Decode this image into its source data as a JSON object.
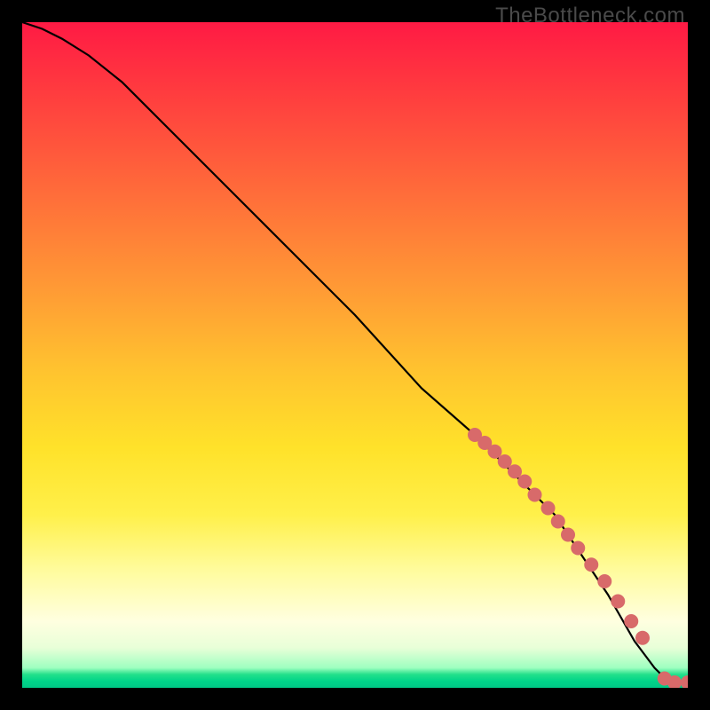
{
  "watermark": "TheBottleneck.com",
  "chart_data": {
    "type": "line",
    "title": "",
    "xlabel": "",
    "ylabel": "",
    "xlim": [
      0,
      100
    ],
    "ylim": [
      0,
      100
    ],
    "grid": false,
    "legend": false,
    "curve": {
      "name": "bottleneck-curve",
      "color": "#000000",
      "x": [
        0,
        3,
        6,
        10,
        15,
        20,
        30,
        40,
        50,
        60,
        68,
        70,
        72,
        74,
        76,
        78,
        80,
        82,
        84,
        86,
        88,
        90,
        92,
        93.5,
        95,
        96.5,
        98,
        100
      ],
      "y": [
        100,
        99,
        97.5,
        95,
        91,
        86,
        76,
        66,
        56,
        45,
        38,
        36,
        34,
        32,
        30,
        28,
        26,
        23,
        20,
        17,
        14,
        10.5,
        7,
        5,
        3,
        1.5,
        0.8,
        0.8
      ]
    },
    "markers": {
      "name": "data-points",
      "color": "#d86a6a",
      "radius": 8,
      "x": [
        68,
        69.5,
        71,
        72.5,
        74,
        75.5,
        77,
        79,
        80.5,
        82,
        83.5,
        85.5,
        87.5,
        89.5,
        91.5,
        93.2,
        96.5,
        98.0,
        100.0
      ],
      "y": [
        38,
        36.8,
        35.5,
        34,
        32.5,
        31,
        29,
        27,
        25,
        23,
        21,
        18.5,
        16,
        13,
        10,
        7.5,
        1.4,
        0.8,
        0.8
      ]
    }
  }
}
